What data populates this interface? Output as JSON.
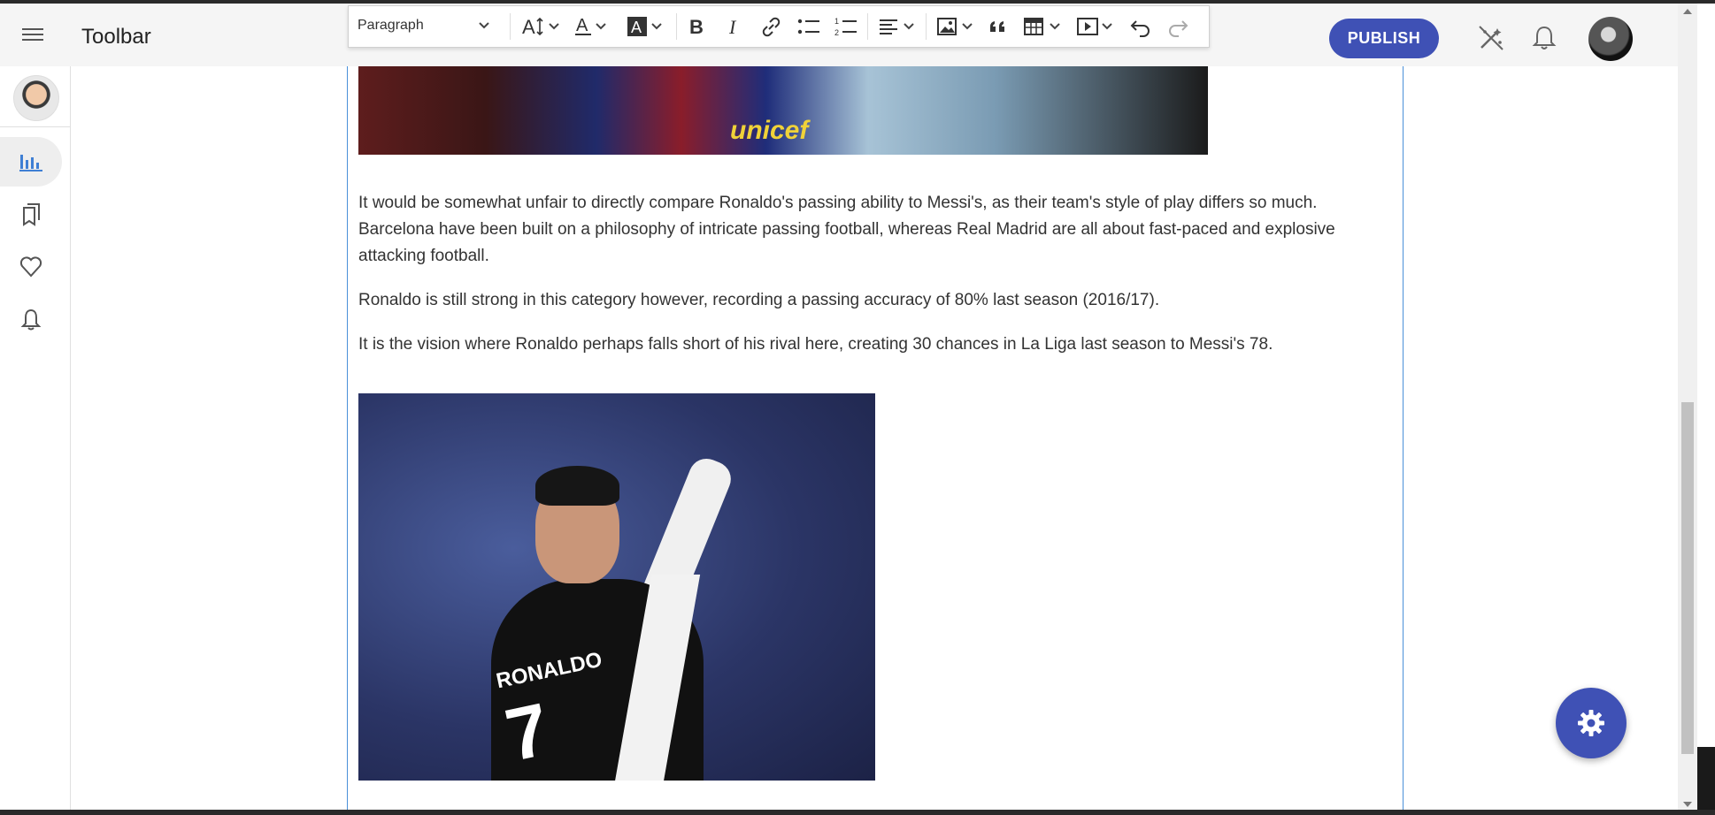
{
  "app": {
    "title": "Toolbar"
  },
  "header": {
    "publish_label": "PUBLISH"
  },
  "toolbar": {
    "paragraph_style": "Paragraph",
    "items": [
      "font-size-icon",
      "font-color-icon",
      "highlight-icon",
      "bold-icon",
      "italic-icon",
      "link-icon",
      "bulleted-list-icon",
      "numbered-list-icon",
      "align-icon",
      "image-icon",
      "blockquote-icon",
      "table-icon",
      "media-icon",
      "undo-icon",
      "redo-icon"
    ]
  },
  "sidebar": {
    "items": [
      "analytics-icon",
      "bookmarks-icon",
      "favorites-icon",
      "notifications-icon"
    ],
    "active": "analytics-icon"
  },
  "article": {
    "top_image_text": "unicef",
    "paragraphs": [
      "It would be somewhat unfair to directly compare Ronaldo's passing ability to Messi's, as their team's style of play differs so much. Barcelona have been built on a philosophy of intricate passing football, whereas Real Madrid are all about fast-paced and explosive attacking football.",
      "Ronaldo is still strong in this category however, recording a passing accuracy of 80% last season (2016/17).",
      "It is the vision where Ronaldo perhaps falls short of his rival here, creating 30 chances in La Liga last season to Messi's 78."
    ],
    "bottom_image": {
      "shirt_name": "RONALDO",
      "shirt_number": "7"
    }
  },
  "colors": {
    "accent": "#3f51b5",
    "editor_border": "#4a90d9"
  }
}
